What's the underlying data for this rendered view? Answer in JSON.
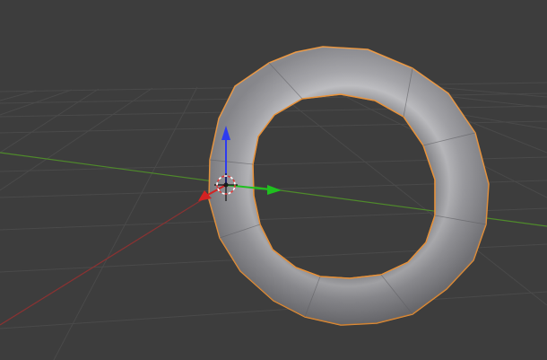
{
  "app": "3D Viewport",
  "viewport": {
    "background": "#3d3d3d",
    "grid_color": "#4a4a4a",
    "x_axis_color": "#9a3535",
    "y_axis_color": "#4f8a2b"
  },
  "object": {
    "type": "torus",
    "state": "selected",
    "outline_color": "#e8923a",
    "surface_color": "#8a8a8e"
  },
  "gizmo": {
    "x_color": "#d32222",
    "y_color": "#1fc01f",
    "z_color": "#2d3bf0",
    "cursor_icon": "3d-cursor-icon"
  }
}
